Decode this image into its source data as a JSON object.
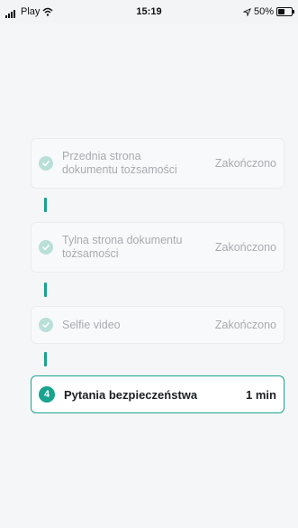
{
  "status_bar": {
    "carrier": "Play",
    "time": "15:19",
    "battery": "50%"
  },
  "steps": [
    {
      "label_line1": "Przednia strona",
      "label_line2": "dokumentu tożsamości",
      "status": "Zakończono",
      "state": "done",
      "icon": "check-icon"
    },
    {
      "label_line1": "Tylna strona dokumentu",
      "label_line2": "tożsamości",
      "status": "Zakończono",
      "state": "done",
      "icon": "check-icon"
    },
    {
      "label_line1": "Selfie video",
      "status": "Zakończono",
      "state": "done",
      "icon": "check-icon"
    },
    {
      "number": "4",
      "label_line1": "Pytania bezpieczeństwa",
      "status": "1 min",
      "state": "active"
    }
  ],
  "colors": {
    "accent": "#18a38f",
    "done_check_bg": "#b9dfd9",
    "muted_text": "#a7abb0"
  }
}
